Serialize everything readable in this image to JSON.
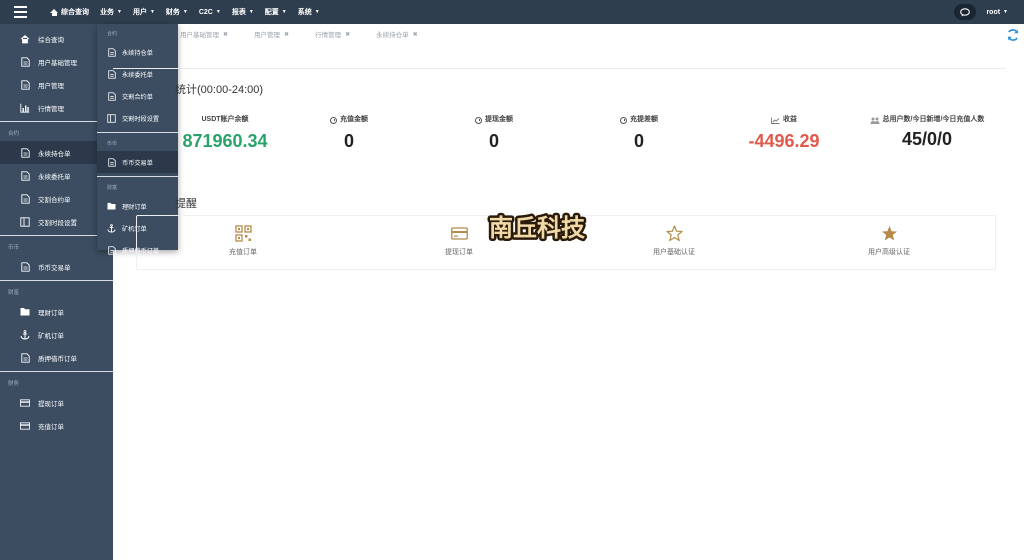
{
  "topnav": {
    "items": [
      {
        "label": "综合查询"
      },
      {
        "label": "业务"
      },
      {
        "label": "用户"
      },
      {
        "label": "财务"
      },
      {
        "label": "C2C"
      },
      {
        "label": "报表"
      },
      {
        "label": "配置"
      },
      {
        "label": "系统"
      }
    ],
    "username": "root"
  },
  "sidebar": {
    "items": [
      {
        "label": "综合查询",
        "icon": "home-icon"
      },
      {
        "label": "用户基础管理",
        "icon": "document-icon"
      },
      {
        "label": "用户管理",
        "icon": "document-icon"
      },
      {
        "label": "行情管理",
        "icon": "bar-chart-icon"
      }
    ],
    "sections": [
      {
        "title": "合约",
        "items": [
          {
            "label": "永续持仓单",
            "icon": "document-icon",
            "active": true
          },
          {
            "label": "永续委托单",
            "icon": "document-icon"
          },
          {
            "label": "交割合约单",
            "icon": "document-icon"
          },
          {
            "label": "交割时段设置",
            "icon": "columns-icon"
          }
        ]
      },
      {
        "title": "币币",
        "items": [
          {
            "label": "币币交易单",
            "icon": "document-icon"
          }
        ]
      },
      {
        "title": "财富",
        "items": [
          {
            "label": "理财订单",
            "icon": "folder-icon"
          },
          {
            "label": "矿机订单",
            "icon": "anchor-icon"
          },
          {
            "label": "质押借币订单",
            "icon": "document-icon"
          }
        ]
      },
      {
        "title": "财务",
        "items": [
          {
            "label": "提现订单",
            "icon": "card-icon"
          },
          {
            "label": "充值订单",
            "icon": "card-icon"
          }
        ]
      }
    ]
  },
  "dropdown": {
    "sections": [
      {
        "title": "合约",
        "items": [
          {
            "label": "永续持仓单"
          },
          {
            "label": "永续委托单"
          },
          {
            "label": "交割合约单"
          },
          {
            "label": "交割时段设置"
          }
        ]
      },
      {
        "title": "币币",
        "items": [
          {
            "label": "币币交易单"
          }
        ]
      },
      {
        "title": "财富",
        "items": [
          {
            "label": "理财订单"
          },
          {
            "label": "矿机订单"
          },
          {
            "label": "质押借币订单"
          }
        ]
      }
    ]
  },
  "tabs": [
    {
      "label": "用户基础管理"
    },
    {
      "label": "用户管理"
    },
    {
      "label": "行情管理"
    },
    {
      "label": "永续持仓单"
    }
  ],
  "stats": {
    "title": "统计(00:00-24:00)",
    "items": [
      {
        "label": "USDT账户余额",
        "value": "871960.34",
        "color": "#2aa36b"
      },
      {
        "label": "充值金额",
        "value": "0",
        "color": "#222222"
      },
      {
        "label": "提现金额",
        "value": "0",
        "color": "#222222"
      },
      {
        "label": "充提差额",
        "value": "0",
        "color": "#222222"
      },
      {
        "label": "收益",
        "value": "-4496.29",
        "color": "#e15a4b"
      },
      {
        "label": "总用户数/今日新增/今日充值人数",
        "value": "45/0/0",
        "color": "#222222"
      }
    ]
  },
  "quick": {
    "title": "提醒",
    "items": [
      {
        "label": "充值订单",
        "icon": "qr-icon"
      },
      {
        "label": "提现订单",
        "icon": "card-icon"
      },
      {
        "label": "用户基础认证",
        "icon": "star-outline-icon"
      },
      {
        "label": "用户高级认证",
        "icon": "star-filled-icon"
      }
    ]
  },
  "logo": {
    "text": "南丘科技"
  },
  "colors": {
    "topbar": "#2f3e4e",
    "sidebar": "#3c4d61",
    "accent": "#b58a4a",
    "green": "#2aa36b",
    "red": "#e15a4b"
  }
}
